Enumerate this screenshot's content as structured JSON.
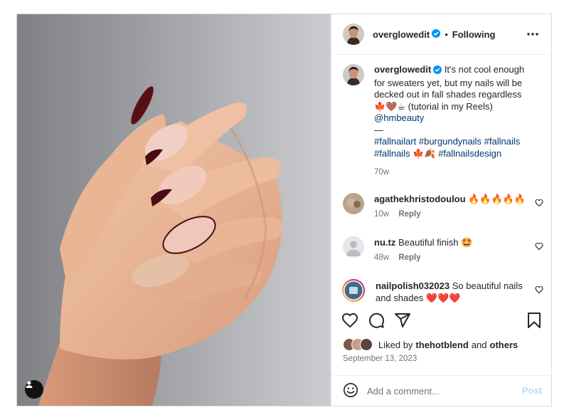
{
  "post": {
    "author": "overglowedit",
    "follow_state": "Following",
    "header_separator": "•",
    "caption_text": "It's not cool enough for sweaters yet, but my nails will be decked out in fall shades regardless 🍁🤎☕ (tutorial in my Reels)",
    "caption_mention": "@hmbeauty",
    "caption_divider": "—",
    "caption_tags_line1": "#fallnailart #burgundynails #fallnails",
    "caption_tags_line2a": "#fallnails 🍁🍂",
    "caption_tags_line2b": "#fallnailsdesign",
    "caption_age": "70w"
  },
  "comments": [
    {
      "user": "agathekhristodoulou",
      "text": "🔥🔥🔥🔥🔥",
      "age": "10w",
      "reply": "Reply"
    },
    {
      "user": "nu.tz",
      "text": "Beautiful finish 🤩",
      "age": "48w",
      "reply": "Reply"
    },
    {
      "user": "nailpolish032023",
      "text": "So beautiful nails and shades ❤️❤️❤️"
    }
  ],
  "likes": {
    "prefix": "Liked by",
    "user": "thehotblend",
    "joiner": "and",
    "others": "others"
  },
  "date": "September 13, 2023",
  "add_comment": {
    "placeholder": "Add a comment...",
    "post_label": "Post"
  },
  "colors": {
    "verified": "#0095f6",
    "link": "#00376b",
    "post_disabled": "#b8dcf7",
    "muted": "#737373"
  },
  "icons": [
    "verified-badge-icon",
    "more-options-icon",
    "heart-icon",
    "comment-icon",
    "share-icon",
    "bookmark-icon",
    "emoji-icon",
    "user-tag-icon"
  ]
}
